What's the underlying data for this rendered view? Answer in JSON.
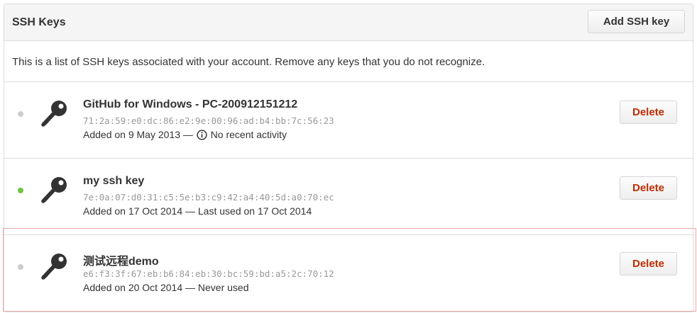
{
  "header": {
    "title": "SSH Keys",
    "add_button_label": "Add SSH key"
  },
  "intro": {
    "text": "This is a list of SSH keys associated with your account. Remove any keys that you do not recognize."
  },
  "keys": [
    {
      "title": "GitHub for Windows - PC-200912151212",
      "fingerprint": "71:2a:59:e0:dc:86:e2:9e:00:96:ad:b4:bb:7c:56:23",
      "added": "Added on 9 May 2013 —",
      "activity": "No recent activity",
      "status": "inactive",
      "status_color": "#cccccc",
      "delete_label": "Delete"
    },
    {
      "title": "my ssh key",
      "fingerprint": "7e:0a:07:d0:31:c5:5e:b3:c9:42:a4:40:5d:a0:70:ec",
      "added": "Added on 17 Oct 2014 — Last used on 17 Oct 2014",
      "status": "active",
      "status_color": "#6cc644",
      "delete_label": "Delete"
    },
    {
      "title": "测试远程demo",
      "fingerprint": "e6:f3:3f:67:eb:b6:84:eb:30:bc:59:bd:a5:2c:70:12",
      "added": "Added on 20 Oct 2014 — Never used",
      "status": "inactive",
      "status_color": "#cccccc",
      "delete_label": "Delete"
    }
  ],
  "colors": {
    "danger": "#bd2c00",
    "border": "#dddddd",
    "highlight": "#e8a8a8"
  },
  "icons": {
    "key": "key-icon",
    "info": "info-icon"
  }
}
